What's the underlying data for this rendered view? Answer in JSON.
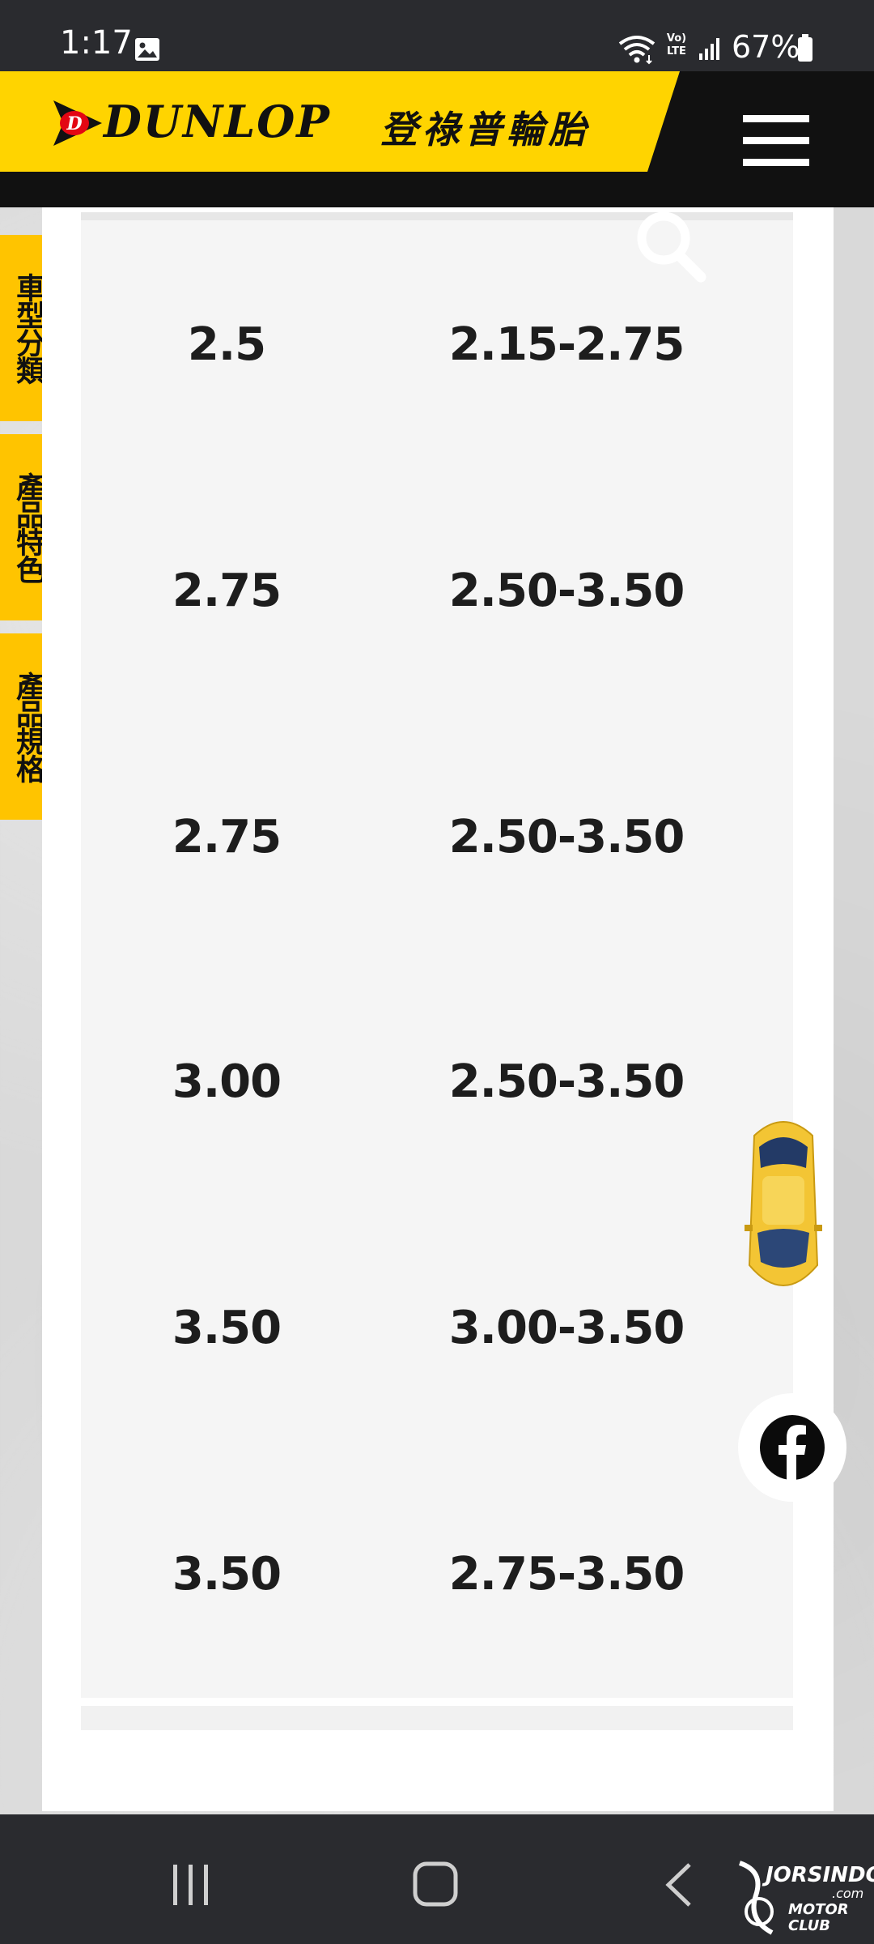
{
  "status_bar": {
    "time": "1:17",
    "battery": "67%",
    "icons": [
      "gallery-icon",
      "wifi-icon",
      "volte-icon",
      "signal-icon",
      "battery-icon"
    ],
    "volte_label": "Vo) LTE"
  },
  "header": {
    "brand": "DUNLOP",
    "brand_cn": "登祿普輪胎",
    "brand_color": "#ffd400",
    "menu_icon": "hamburger-menu-icon"
  },
  "side_tabs": [
    {
      "label": "車型分類"
    },
    {
      "label": "產品特色"
    },
    {
      "label": "產品規格"
    }
  ],
  "spec_table": {
    "rows": [
      {
        "rim": "2.5",
        "range": "2.15-2.75"
      },
      {
        "rim": "2.75",
        "range": "2.50-3.50"
      },
      {
        "rim": "2.75",
        "range": "2.50-3.50"
      },
      {
        "rim": "3.00",
        "range": "2.50-3.50"
      },
      {
        "rim": "3.50",
        "range": "3.00-3.50"
      },
      {
        "rim": "3.50",
        "range": "2.75-3.50"
      }
    ]
  },
  "floating": {
    "search_icon": "search-icon",
    "car_icon": "car-icon",
    "facebook_icon": "facebook-icon"
  },
  "nav_bar": {
    "buttons": [
      "recents-icon",
      "home-icon",
      "back-icon"
    ],
    "watermark_top": "JORSINDO",
    "watermark_com": ".com",
    "watermark_bottom": "MOTOR CLUB"
  }
}
